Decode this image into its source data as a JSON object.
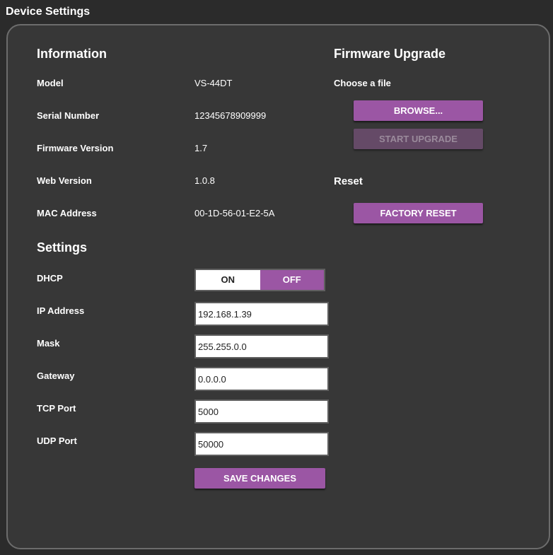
{
  "page_title": "Device Settings",
  "information": {
    "title": "Information",
    "rows": [
      {
        "label": "Model",
        "value": "VS-44DT"
      },
      {
        "label": "Serial Number",
        "value": "12345678909999"
      },
      {
        "label": "Firmware Version",
        "value": "1.7"
      },
      {
        "label": "Web Version",
        "value": "1.0.8"
      },
      {
        "label": "MAC Address",
        "value": "00-1D-56-01-E2-5A"
      }
    ]
  },
  "firmware": {
    "title": "Firmware Upgrade",
    "choose_label": "Choose a file",
    "browse_label": "BROWSE...",
    "start_label": "START UPGRADE"
  },
  "reset": {
    "title": "Reset",
    "factory_reset_label": "FACTORY RESET"
  },
  "settings": {
    "title": "Settings",
    "dhcp": {
      "label": "DHCP",
      "on_label": "ON",
      "off_label": "OFF",
      "selected": "OFF"
    },
    "fields": [
      {
        "label": "IP Address",
        "value": "192.168.1.39"
      },
      {
        "label": "Mask",
        "value": "255.255.0.0"
      },
      {
        "label": "Gateway",
        "value": "0.0.0.0"
      },
      {
        "label": "TCP Port",
        "value": "5000"
      },
      {
        "label": "UDP Port",
        "value": "50000"
      }
    ],
    "save_label": "SAVE CHANGES"
  },
  "colors": {
    "accent": "#9b56a4",
    "panel_bg": "#373737",
    "page_bg": "#2b2b2b"
  }
}
